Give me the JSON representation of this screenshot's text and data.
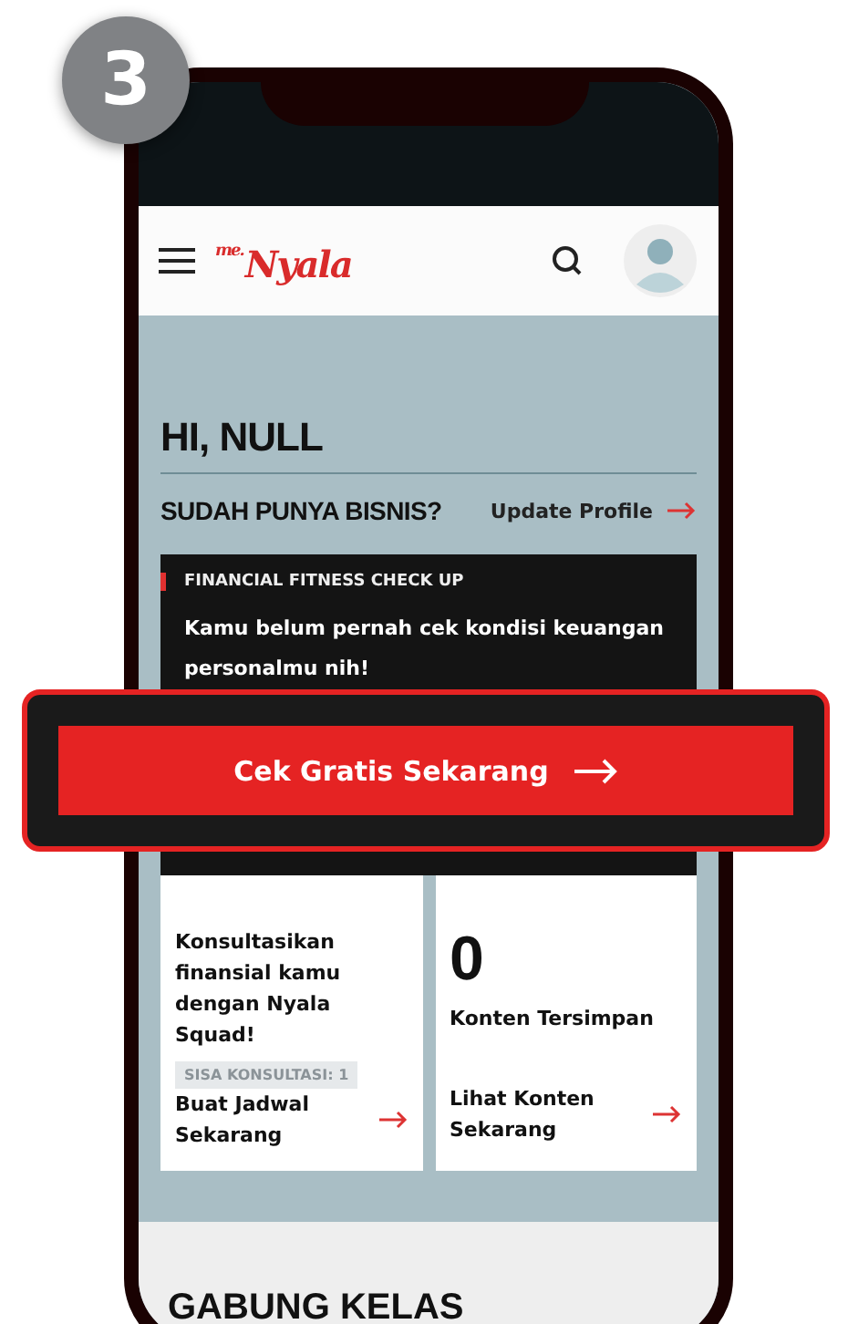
{
  "step_badge": "3",
  "header": {
    "logo_small": "me.",
    "logo": "Nyala"
  },
  "greeting": "HI, NULL",
  "business": {
    "question": "SUDAH PUNYA BISNIS?",
    "link": "Update Profile"
  },
  "checkup": {
    "label": "FINANCIAL FITNESS CHECK UP",
    "text": "Kamu belum pernah cek kondisi keuangan personalmu nih!",
    "button": "Cek Gratis Sekarang"
  },
  "cards": [
    {
      "kind": "consult",
      "text": "Konsultasikan finansial kamu dengan Nyala Squad!",
      "tag": "SISA KONSULTASI: 1",
      "link": "Buat Jadwal Sekarang"
    },
    {
      "kind": "saved",
      "count": "0",
      "text": "Konten Tersimpan",
      "link": "Lihat Konten Sekarang"
    }
  ],
  "section_title": "GABUNG KELAS"
}
